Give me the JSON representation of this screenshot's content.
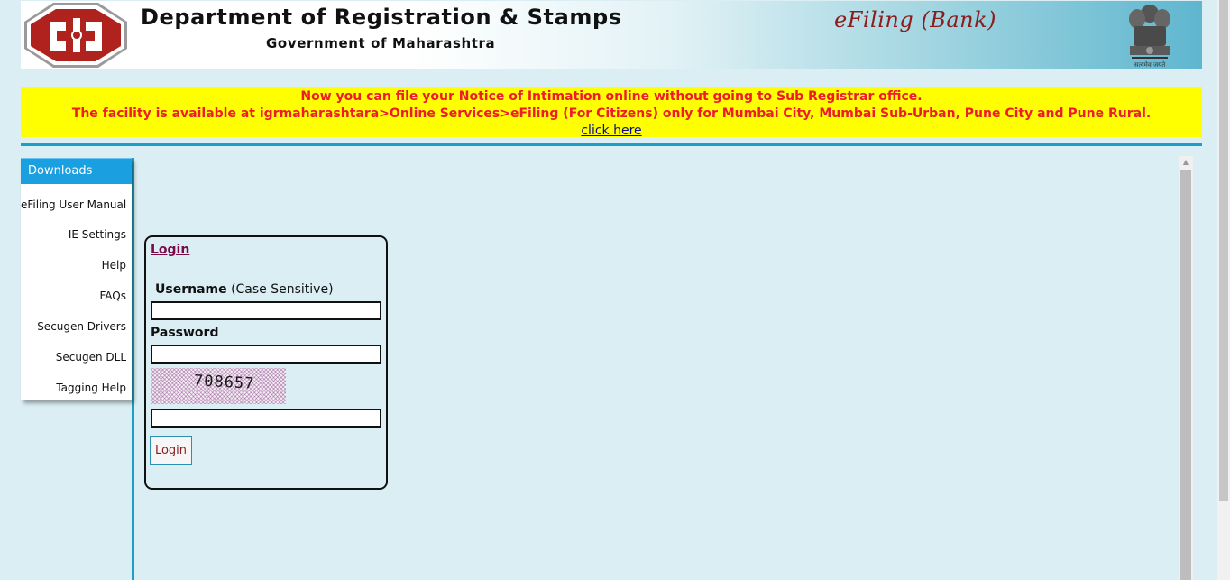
{
  "header": {
    "title": "Department of Registration & Stamps",
    "subtitle": "Government of Maharashtra",
    "badge": "eFiling (Bank)",
    "emblem_caption": "सत्यमेव जयते"
  },
  "notice": {
    "line1": "Now you can file your Notice of Intimation online without going to Sub Registrar office.",
    "line2": "The facility is available at igrmaharashtara>Online Services>eFiling (For Citizens) only for Mumbai City, Mumbai Sub-Urban, Pune City and Pune Rural.",
    "link_label": "click here"
  },
  "sidebar": {
    "header": "Downloads",
    "items": [
      {
        "label": "eFiling User Manual"
      },
      {
        "label": "IE Settings"
      },
      {
        "label": "Help"
      },
      {
        "label": "FAQs"
      },
      {
        "label": "Secugen Drivers"
      },
      {
        "label": "Secugen DLL"
      },
      {
        "label": "Tagging Help"
      }
    ]
  },
  "login": {
    "heading": "Login",
    "username_label": "Username",
    "username_hint": "(Case Sensitive)",
    "username_value": "",
    "password_label": "Password",
    "password_value": "",
    "captcha_text": "708657",
    "captcha_value": "",
    "button_label": "Login"
  },
  "colors": {
    "page_bg": "#dbeef3",
    "accent": "#1a9fc6",
    "notice_bg": "#ffff00",
    "notice_text": "#ee1b2d",
    "badge_text": "#8c1c1c",
    "logo_red": "#b0221e"
  }
}
